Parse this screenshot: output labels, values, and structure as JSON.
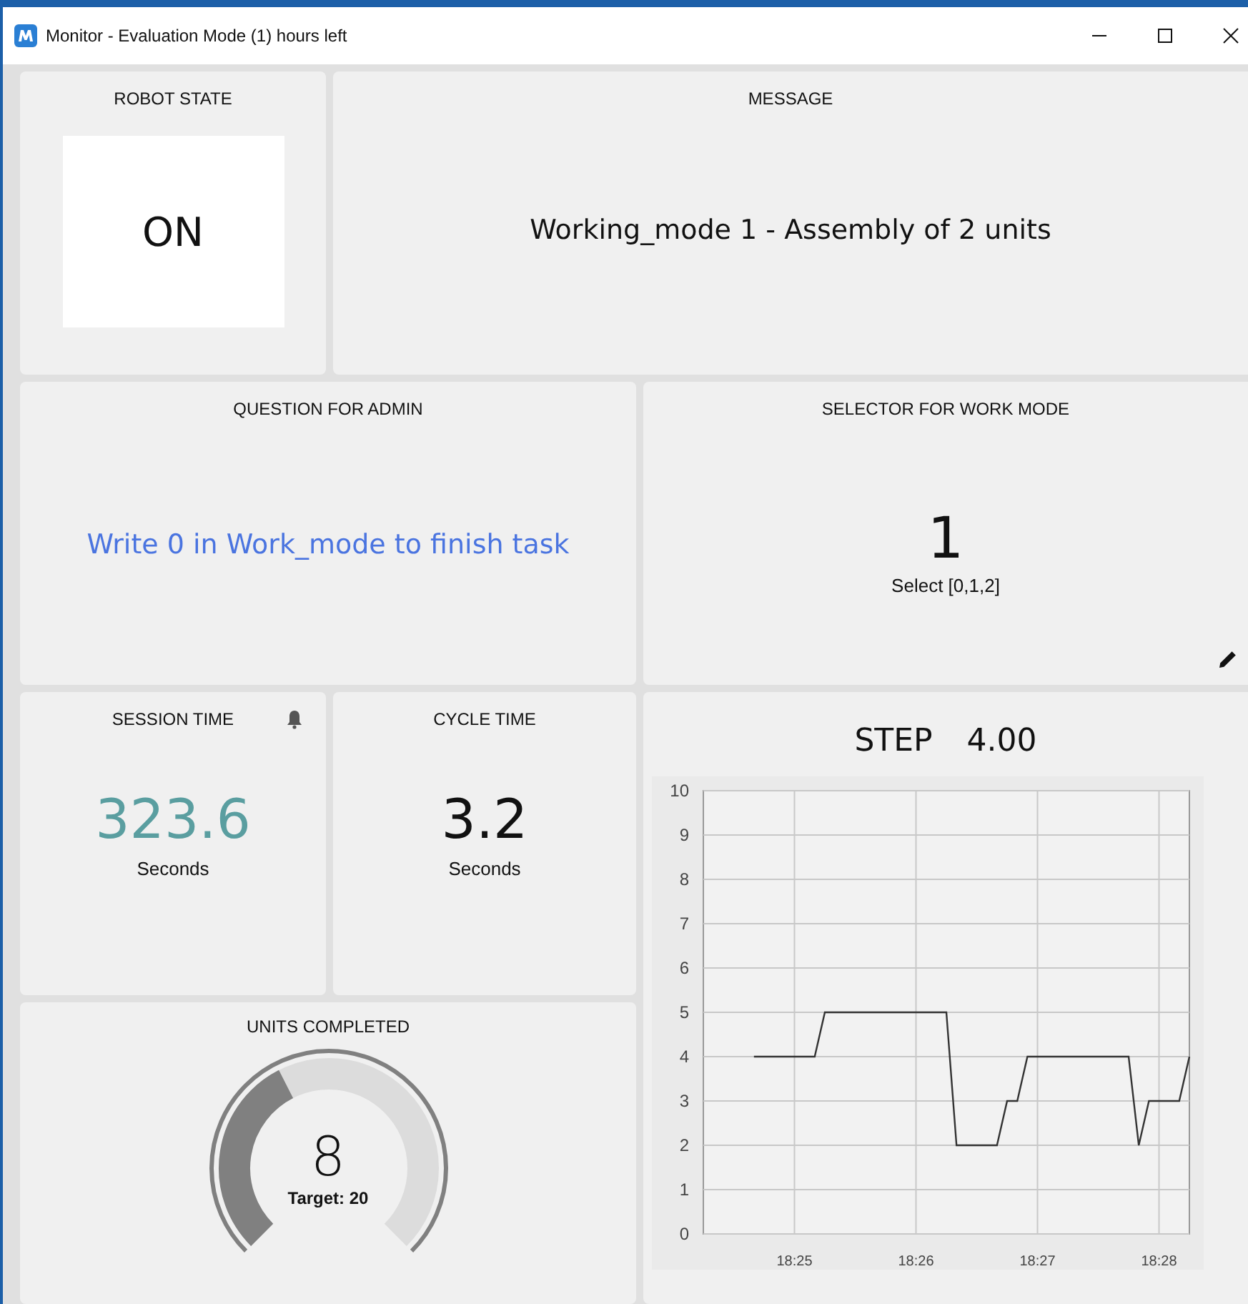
{
  "window": {
    "title": "Monitor - Evaluation Mode (1) hours left"
  },
  "robot_state": {
    "title": "ROBOT STATE",
    "value": "ON"
  },
  "message": {
    "title": "MESSAGE",
    "text": "Working_mode 1 - Assembly of 2 units"
  },
  "question": {
    "title": "QUESTION FOR ADMIN",
    "text": "Write 0 in Work_mode to finish task"
  },
  "selector": {
    "title": "SELECTOR FOR WORK MODE",
    "value": "1",
    "hint": "Select [0,1,2]"
  },
  "session_time": {
    "title": "SESSION TIME",
    "value": "323.6",
    "unit": "Seconds"
  },
  "cycle_time": {
    "title": "CYCLE TIME",
    "value": "3.2",
    "unit": "Seconds"
  },
  "units_completed": {
    "title": "UNITS COMPLETED",
    "value": "8",
    "target": "Target: 20"
  },
  "step": {
    "title": "STEP",
    "value": "4.00",
    "chart_data": {
      "type": "line",
      "grid": true,
      "categories": [
        null,
        null,
        null,
        null,
        null,
        null,
        null,
        null,
        null,
        "18:25",
        null,
        null,
        null,
        null,
        null,
        null,
        null,
        null,
        null,
        null,
        null,
        "18:26",
        null,
        null,
        null,
        null,
        null,
        null,
        null,
        null,
        null,
        null,
        null,
        "18:27",
        null,
        null,
        null,
        null,
        null,
        null,
        null,
        null,
        null,
        null,
        null,
        "18:28",
        null,
        null,
        null
      ],
      "series": [
        {
          "color": "#333333",
          "values": [
            null,
            null,
            null,
            null,
            null,
            4,
            4,
            4,
            4,
            4,
            4,
            4,
            5,
            5,
            5,
            5,
            5,
            5,
            5,
            5,
            5,
            5,
            5,
            5,
            5,
            2,
            2,
            2,
            2,
            2,
            3,
            3,
            4,
            4,
            4,
            4,
            4,
            4,
            4,
            4,
            4,
            4,
            4,
            2,
            3,
            3,
            3,
            3,
            4
          ]
        }
      ],
      "ylim": [
        0,
        10
      ],
      "yticks": [
        0,
        1,
        2,
        3,
        4,
        5,
        6,
        7,
        8,
        9,
        10
      ]
    }
  }
}
